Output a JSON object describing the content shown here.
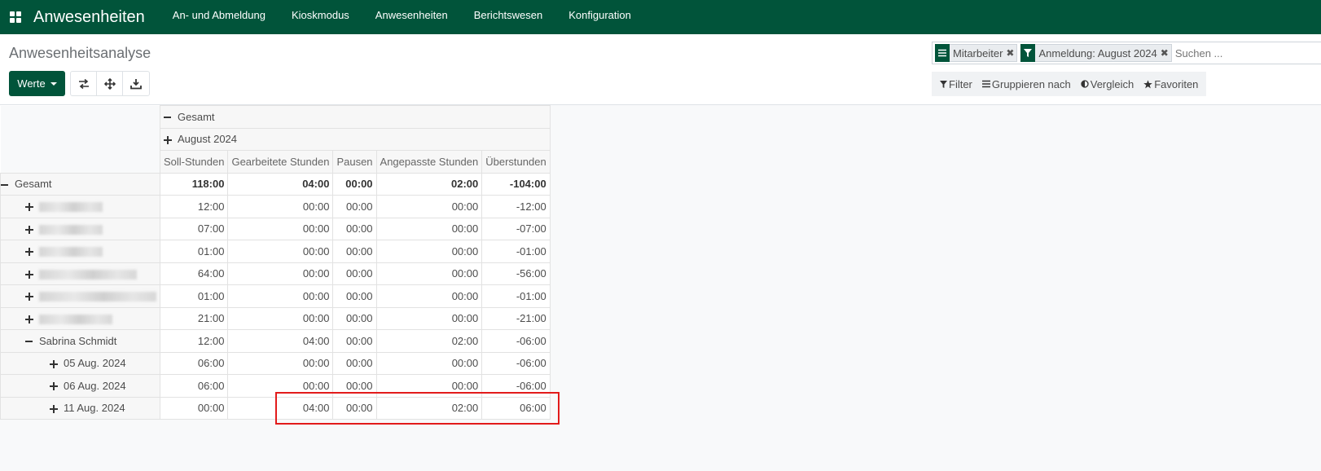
{
  "navbar": {
    "apps_icon": "apps-grid-icon",
    "app_title": "Anwesenheiten",
    "menu": [
      "An- und Abmeldung",
      "Kioskmodus",
      "Anwesenheiten",
      "Berichtswesen",
      "Konfiguration"
    ]
  },
  "control_panel": {
    "breadcrumb": "Anwesenheitsanalyse",
    "werte_label": "Werte",
    "toolbar_icons": [
      "flip-axis-icon",
      "expand-all-icon",
      "download-icon"
    ],
    "search": {
      "facets": [
        {
          "icon": "group-by-icon",
          "label": "Mitarbeiter"
        },
        {
          "icon": "filter-icon",
          "label": "Anmeldung: August 2024"
        }
      ],
      "placeholder": "Suchen ..."
    },
    "filter_bar": [
      {
        "icon": "filter-icon",
        "label": "Filter"
      },
      {
        "icon": "list-icon",
        "label": "Gruppieren nach"
      },
      {
        "icon": "half-circle-icon",
        "label": "Vergleich"
      },
      {
        "icon": "star-icon",
        "label": "Favoriten"
      }
    ]
  },
  "pivot": {
    "col_total": "Gesamt",
    "col_group": "August 2024",
    "measures": [
      "Soll-Stunden",
      "Gearbeitete Stunden",
      "Pausen",
      "Angepasste Stunden",
      "Überstunden"
    ],
    "total_row": {
      "label": "Gesamt",
      "values": [
        "118:00",
        "04:00",
        "00:00",
        "02:00",
        "-104:00"
      ]
    },
    "rows": [
      {
        "label": "",
        "blurred": true,
        "values": [
          "12:00",
          "00:00",
          "00:00",
          "00:00",
          "-12:00"
        ]
      },
      {
        "label": "",
        "blurred": true,
        "values": [
          "07:00",
          "00:00",
          "00:00",
          "00:00",
          "-07:00"
        ]
      },
      {
        "label": "",
        "blurred": true,
        "values": [
          "01:00",
          "00:00",
          "00:00",
          "00:00",
          "-01:00"
        ]
      },
      {
        "label": "",
        "blurred": true,
        "values": [
          "64:00",
          "00:00",
          "00:00",
          "00:00",
          "-56:00"
        ]
      },
      {
        "label": "",
        "blurred": true,
        "values": [
          "01:00",
          "00:00",
          "00:00",
          "00:00",
          "-01:00"
        ]
      },
      {
        "label": "",
        "blurred": true,
        "values": [
          "21:00",
          "00:00",
          "00:00",
          "00:00",
          "-21:00"
        ]
      },
      {
        "label": "Sabrina Schmidt",
        "expanded": true,
        "values": [
          "12:00",
          "04:00",
          "00:00",
          "02:00",
          "-06:00"
        ]
      },
      {
        "label": "05 Aug. 2024",
        "level": 2,
        "values": [
          "06:00",
          "00:00",
          "00:00",
          "00:00",
          "-06:00"
        ]
      },
      {
        "label": "06 Aug. 2024",
        "level": 2,
        "values": [
          "06:00",
          "00:00",
          "00:00",
          "00:00",
          "-06:00"
        ]
      },
      {
        "label": "11 Aug. 2024",
        "level": 2,
        "values": [
          "00:00",
          "04:00",
          "00:00",
          "02:00",
          "06:00"
        ]
      }
    ]
  },
  "colors": {
    "brand": "#01543a",
    "highlight": "#e21b1b"
  }
}
